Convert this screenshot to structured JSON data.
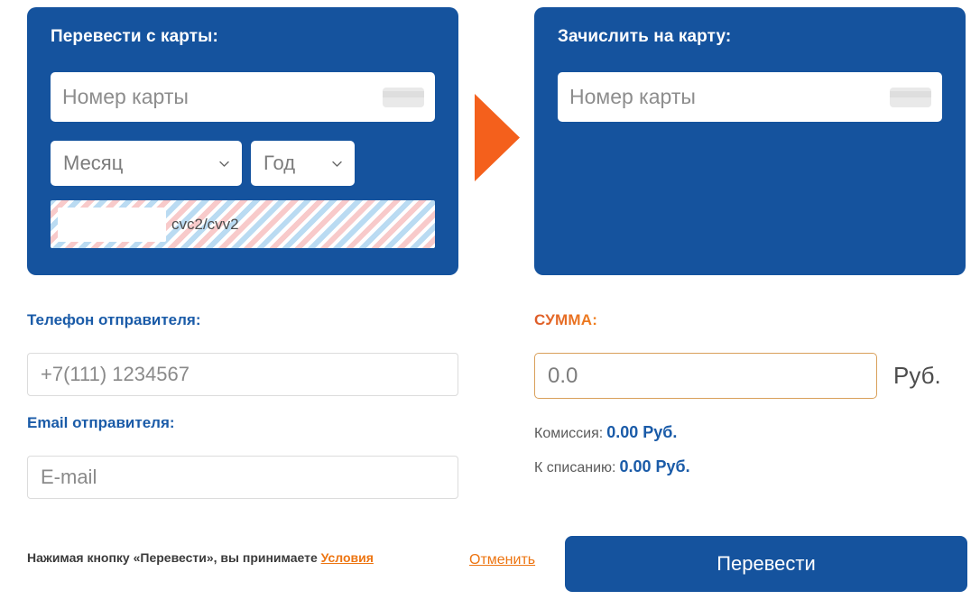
{
  "colors": {
    "panel_blue": "#15539E",
    "accent_orange": "#ED7512",
    "summa_gradient_start": "#DD5C2B",
    "summa_gradient_end": "#F07E1C",
    "link_blue": "#1A5BA8",
    "amount_border": "#D9A05A",
    "input_border": "#DCDCDC",
    "placeholder_gray": "#8A8A8A"
  },
  "panel_from": {
    "title": "Перевести с карты:",
    "card_number_placeholder": "Номер карты",
    "card_icon": "credit-card-icon",
    "month_select": {
      "value": "Месяц",
      "chevron": "chevron-down-icon"
    },
    "year_select": {
      "value": "Год",
      "chevron": "chevron-down-icon"
    },
    "cvc": {
      "value": "",
      "hint": "cvc2/cvv2"
    }
  },
  "arrow": {
    "icon": "arrow-right-triangle-icon",
    "color": "#F4601C"
  },
  "panel_to": {
    "title": "Зачислить на карту:",
    "card_number_placeholder": "Номер карты",
    "card_icon": "credit-card-icon"
  },
  "sender": {
    "phone_label": "Телефон отправителя:",
    "phone_placeholder": "+7(111) 1234567",
    "phone_value": "",
    "email_label": "Email отправителя:",
    "email_placeholder": "E-mail",
    "email_value": ""
  },
  "amount": {
    "label": "СУММА:",
    "placeholder": "0.0",
    "value": "",
    "currency": "Руб.",
    "commission_label": "Комиссия:",
    "commission_value": "0.00 Руб.",
    "total_label": "К списанию:",
    "total_value": "0.00 Руб."
  },
  "footer": {
    "terms_prefix": "Нажимая кнопку «Перевести», вы принимаете ",
    "terms_link": "Условия",
    "cancel_label": "Отменить",
    "submit_label": "Перевести"
  }
}
